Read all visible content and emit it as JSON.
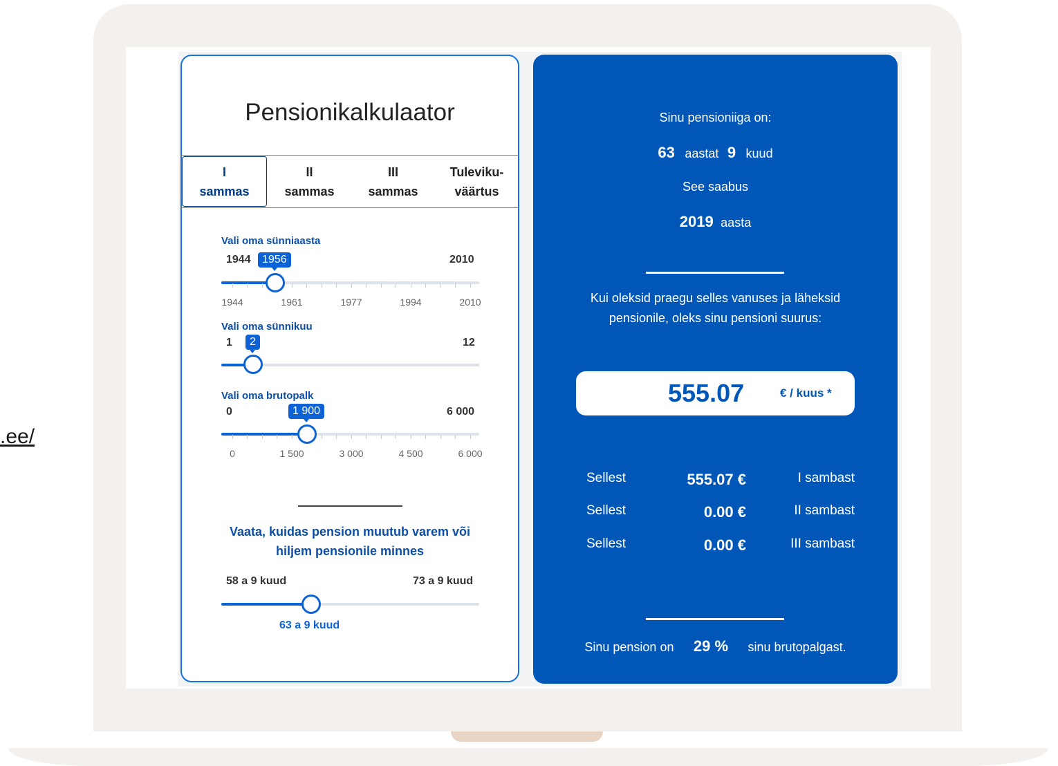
{
  "side_link": ".ee/",
  "calculator": {
    "title": "Pensionikalkulaator",
    "tabs": [
      {
        "line1": "I",
        "line2": "sammas",
        "active": true
      },
      {
        "line1": "II",
        "line2": "sammas",
        "active": false
      },
      {
        "line1": "III",
        "line2": "sammas",
        "active": false
      },
      {
        "line1": "Tuleviku-",
        "line2": "väärtus",
        "active": false
      }
    ],
    "birth_year": {
      "label": "Vali oma sünniaasta",
      "min": "1944",
      "max": "2010",
      "value": "1956",
      "ticks": [
        "1944",
        "1961",
        "1977",
        "1994",
        "2010"
      ]
    },
    "birth_month": {
      "label": "Vali oma sünnikuu",
      "min": "1",
      "max": "12",
      "value": "2"
    },
    "gross_salary": {
      "label": "Vali oma brutopalk",
      "min": "0",
      "max": "6 000",
      "value": "1 900",
      "ticks": [
        "0",
        "1 500",
        "3 000",
        "4 500",
        "6 000"
      ]
    },
    "retirement_promo": "Vaata, kuidas pension muutub varem või hiljem pensionile minnes",
    "retirement_age": {
      "min": "58 a 9 kuud",
      "max": "73 a 9 kuud",
      "value": "63 a 9 kuud"
    }
  },
  "result": {
    "age_label": "Sinu pensioniiga on:",
    "age_years": "63",
    "years_word": "aastat",
    "age_months": "9",
    "months_word": "kuud",
    "arrives_label": "See saabus",
    "year": "2019",
    "year_word": "aasta",
    "description_line1": "Kui oleksid praegu selles vanuses ja läheksid",
    "description_line2": "pensionile, oleks sinu pensioni suurus:",
    "pension_amount": "555.07",
    "pension_unit": "€ / kuus *",
    "breakdown": [
      {
        "prefix": "Sellest",
        "amount": "555.07 €",
        "source": "I sambast"
      },
      {
        "prefix": "Sellest",
        "amount": "0.00 €",
        "source": "II sambast"
      },
      {
        "prefix": "Sellest",
        "amount": "0.00 €",
        "source": "III sambast"
      }
    ],
    "ratio_prefix": "Sinu pension on",
    "ratio_value": "29 %",
    "ratio_suffix": "sinu brutopalgast."
  },
  "colors": {
    "primary_blue": "#0057b7",
    "accent_blue": "#0d63d6",
    "heading_blue": "#0d4fa8",
    "laptop_frame": "#f3f0ee"
  }
}
